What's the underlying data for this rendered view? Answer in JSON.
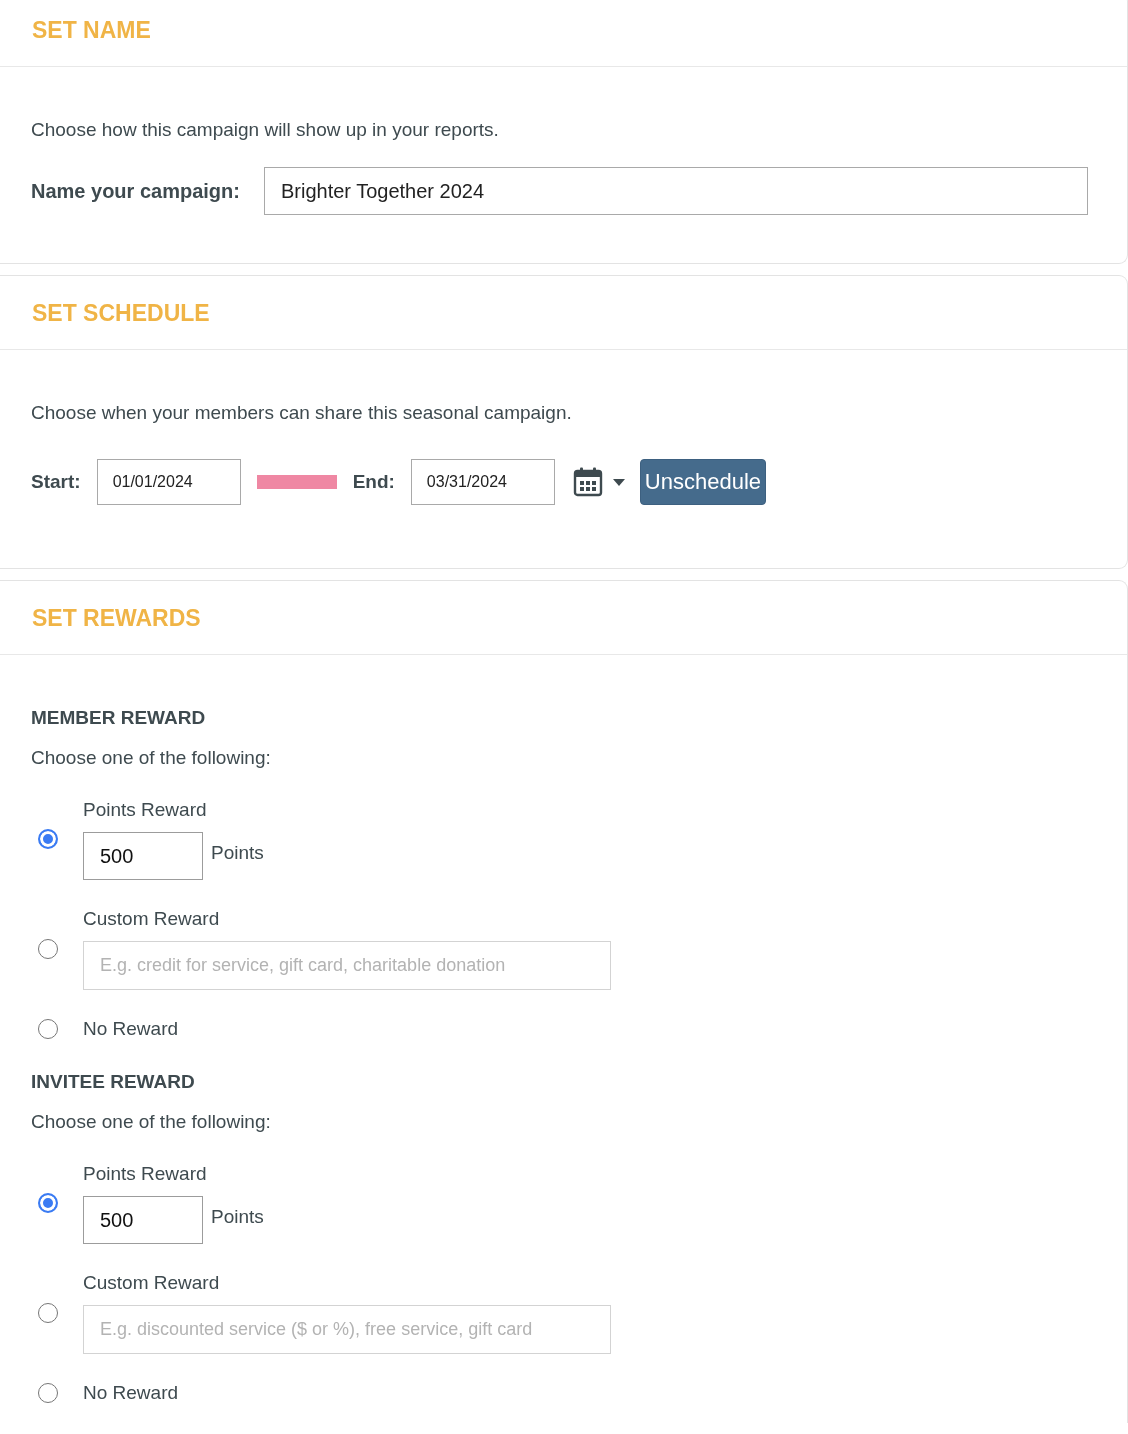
{
  "sections": [
    {
      "kind": "name",
      "title": "SET NAME",
      "description": "Choose how this campaign will show up in your reports.",
      "field": {
        "label": "Name your campaign:",
        "value": "Brighter Together 2024"
      }
    },
    {
      "kind": "schedule",
      "title": "SET SCHEDULE",
      "description": "Choose when your members can share this seasonal campaign.",
      "start": {
        "label": "Start:",
        "value": "01/01/2024"
      },
      "end": {
        "label": "End:",
        "value": "03/31/2024"
      },
      "button": "Unschedule"
    },
    {
      "kind": "rewards",
      "title": "SET REWARDS",
      "groups": [
        {
          "heading": "MEMBER REWARD",
          "instruction": "Choose one of the following:",
          "options": [
            {
              "kind": "points",
              "label": "Points Reward",
              "selected": true,
              "value": "500",
              "unit": "Points"
            },
            {
              "kind": "custom",
              "label": "Custom Reward",
              "selected": false,
              "placeholder": "E.g. credit for service, gift card, charitable donation"
            },
            {
              "kind": "none",
              "label": "No Reward",
              "selected": false
            }
          ]
        },
        {
          "heading": "INVITEE REWARD",
          "instruction": "Choose one of the following:",
          "options": [
            {
              "kind": "points",
              "label": "Points Reward",
              "selected": true,
              "value": "500",
              "unit": "Points"
            },
            {
              "kind": "custom",
              "label": "Custom Reward",
              "selected": false,
              "placeholder": "E.g. discounted service ($ or %), free service, gift card"
            },
            {
              "kind": "none",
              "label": "No Reward",
              "selected": false
            }
          ]
        }
      ]
    }
  ]
}
